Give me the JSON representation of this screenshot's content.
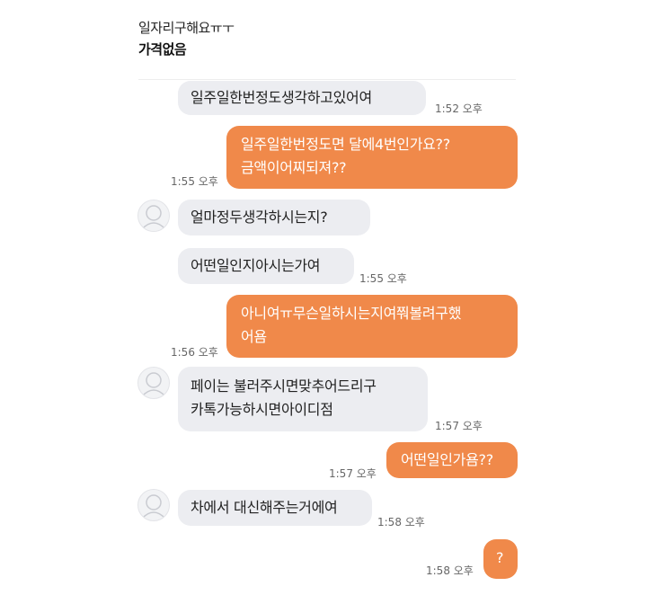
{
  "header": {
    "name": "일자리구해요ㅠㅜ",
    "subtitle": "가격없음"
  },
  "messages": [
    {
      "side": "received",
      "text": "일주일한번정도생각하고있어여",
      "time": "1:52 오후"
    },
    {
      "side": "sent",
      "line1": "일주일한번정도면 달에4번인가요??",
      "line2": "금액이어찌되져??",
      "time": "1:55 오후"
    },
    {
      "side": "received",
      "text": "얼마정두생각하시는지?"
    },
    {
      "side": "received",
      "text": "어떤일인지아시는가여",
      "time": "1:55 오후"
    },
    {
      "side": "sent",
      "line1": "아니여ㅠ무슨일하시는지여쭤볼려구했",
      "line2": "어욤",
      "time": "1:56 오후"
    },
    {
      "side": "received",
      "line1": "페이는 불러주시면맞추어드리구",
      "line2": "카톡가능하시면아이디점",
      "time": "1:57 오후"
    },
    {
      "side": "sent",
      "text": "어떤일인가욤??",
      "time": "1:57 오후"
    },
    {
      "side": "received",
      "text": "차에서 대신해주는거에여",
      "time": "1:58 오후"
    },
    {
      "side": "sent",
      "text": "?",
      "time": "1:58 오후"
    }
  ],
  "colors": {
    "sent_bubble": "#f0894a",
    "received_bubble": "#ecedf1"
  },
  "icons": {
    "avatar": "default-profile-icon"
  }
}
